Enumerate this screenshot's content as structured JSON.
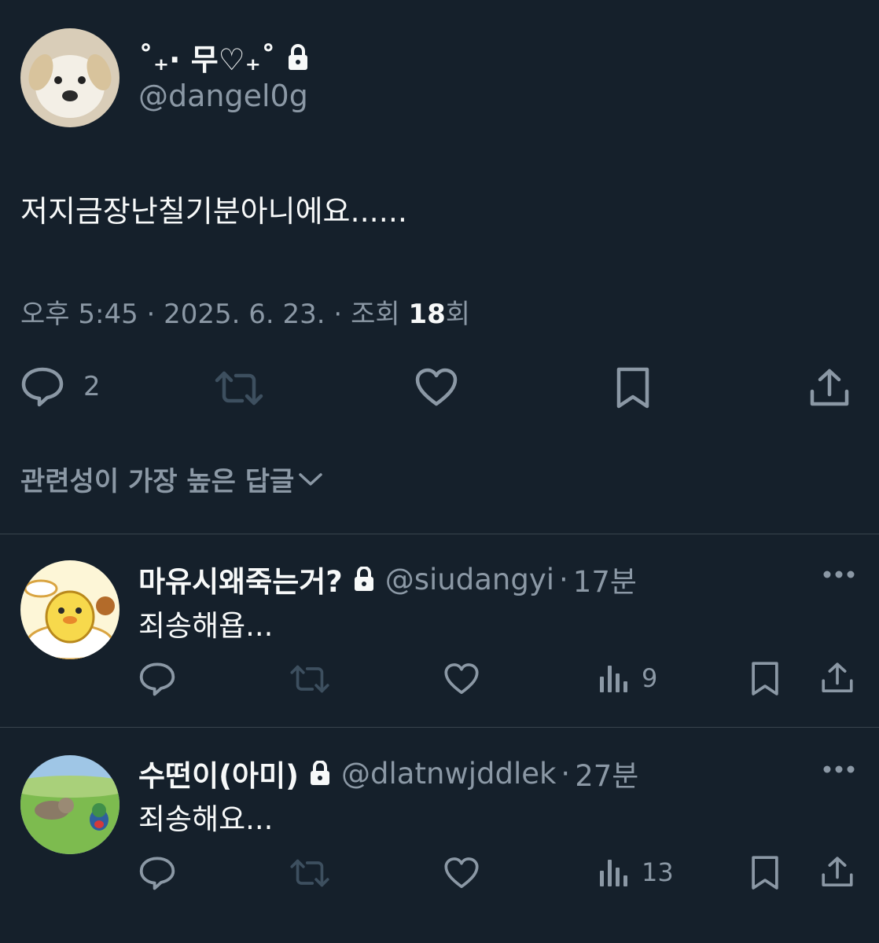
{
  "main_tweet": {
    "display_name": "˚₊· 무♡₊˚",
    "handle": "@dangel0g",
    "text": "저지금장난칠기분아니에요......",
    "meta": {
      "time": "오후 5:45",
      "date": "2025. 6. 23.",
      "views_prefix": "조회",
      "views_count": "18",
      "views_suffix": "회"
    },
    "actions": {
      "reply_count": "2"
    }
  },
  "sort_label": "관련성이 가장 높은 답글",
  "replies": [
    {
      "name": "마유시왜죽는거?",
      "handle": "@siudangyi",
      "time": "17분",
      "text": "죄송해욥...",
      "views": "9"
    },
    {
      "name": "수떤이(아미)",
      "handle": "@dlatnwjddlek",
      "time": "27분",
      "text": "죄송해요...",
      "views": "13"
    }
  ],
  "colors": {
    "background": "#15202b",
    "text_primary": "#f7f9f9",
    "text_secondary": "#8b98a5",
    "divider": "#38444d"
  }
}
